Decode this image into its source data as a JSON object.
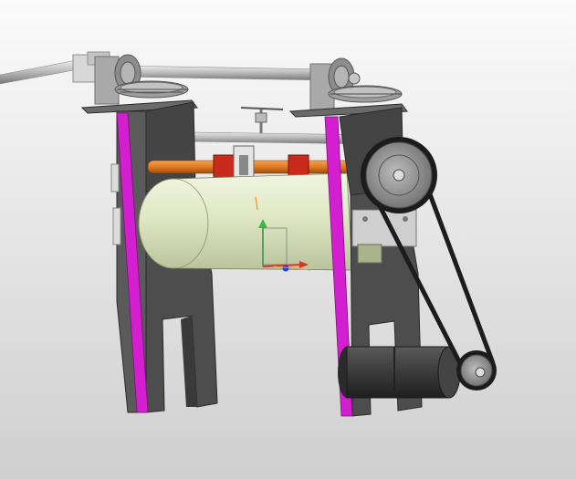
{
  "viewport": {
    "background_top": "#fbfbfb",
    "background_bottom": "#cfcfcf"
  },
  "model": {
    "parts": [
      "input-shaft",
      "bevel-gear-left",
      "bevel-gear-right",
      "top-shaft",
      "side-frame-left",
      "side-frame-right",
      "magenta-plate-left",
      "magenta-plate-right",
      "guide-rod",
      "tension-screw-handle",
      "orange-roller",
      "red-bearing-blocks",
      "main-drum",
      "large-pulley",
      "small-pulley",
      "drive-belt",
      "motor"
    ],
    "colors": {
      "frame": "#4d4d4d",
      "frame_edge": "#2b2b2b",
      "accent_plate": "#d31fd0",
      "drum": "#dfe8c3",
      "roller": "#e17a1f",
      "bearing_block": "#c92a1c",
      "pulley": "#8a8a8a",
      "belt": "#1c1c1c",
      "shaft": "#b8b8b8",
      "motor": "#3a3a3a"
    }
  },
  "triad": {
    "x_color": "#d9342b",
    "y_color": "#35b84a",
    "z_color": "#2a3fd6"
  }
}
